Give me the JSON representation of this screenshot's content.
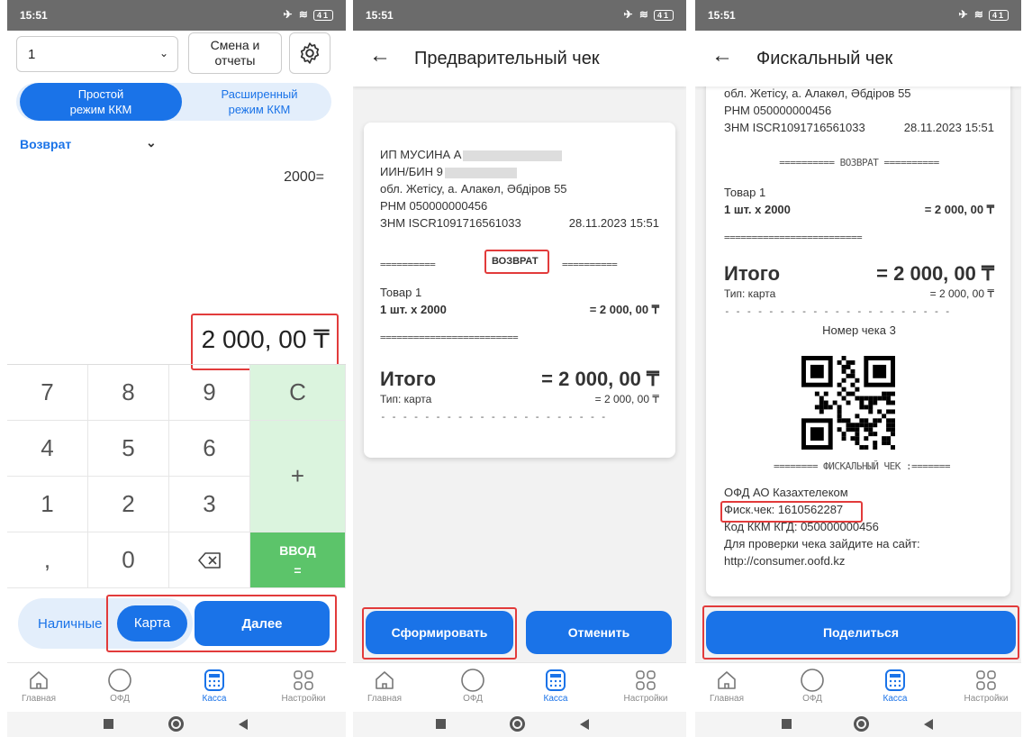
{
  "status": {
    "time": "15:51",
    "battery": "41"
  },
  "screen1": {
    "select_value": "1",
    "shift_button": "Смена и\nотчеты",
    "mode_simple": "Простой\nрежим ККМ",
    "mode_extended": "Расширенный\nрежим ККМ",
    "operation": "Возврат",
    "expression": "2000=",
    "amount": "2 000, 00 ₸",
    "keys": [
      "7",
      "8",
      "9",
      "C",
      "4",
      "5",
      "6",
      "+",
      "1",
      "2",
      "3",
      ",",
      "0"
    ],
    "enter_label": "ВВОД\n=",
    "pay_cash": "Наличные",
    "pay_card": "Карта",
    "next_button": "Далее"
  },
  "screen2": {
    "title": "Предварительный чек",
    "seller": "ИП МУСИНА А",
    "iin": "ИИН/БИН 9",
    "address": "обл. Жетісу, а. Алакөл, Әбдіров 55",
    "rnm": "РНМ 050000000456",
    "znm": "ЗНМ ISCR1091716561033",
    "datetime": "28.11.2023 15:51",
    "sep_left": "==========",
    "op_label": "ВОЗВРАТ",
    "sep_right": "==========",
    "item_name": "Товар 1",
    "item_qty": "1 шт. x 2000",
    "item_sum": "= 2 000, 00 ₸",
    "sep_full": "=========================",
    "total_label": "Итого",
    "total_value": "= 2 000, 00 ₸",
    "pay_type": "Тип: карта",
    "pay_sum": "= 2 000, 00 ₸",
    "dash_line": "- - - - - - - - - - - - - - - - - - - - -",
    "form_button": "Сформировать",
    "cancel_button": "Отменить"
  },
  "screen3": {
    "title": "Фискальный чек",
    "address": "обл. Жетісу, а. Алакөл, Әбдіров 55",
    "rnm": "РНМ 050000000456",
    "znm": "ЗНМ ISCR1091716561033",
    "datetime": "28.11.2023 15:51",
    "sep_op": "==========  ВОЗВРАТ  ==========",
    "item_name": "Товар 1",
    "item_qty": "1 шт. x 2000",
    "item_sum": "= 2 000, 00 ₸",
    "sep_full": "=========================",
    "total_label": "Итого",
    "total_value": "= 2 000, 00 ₸",
    "pay_type": "Тип: карта",
    "pay_sum": "= 2 000, 00 ₸",
    "dash_line": "- - - - - - - - - - - - - - - - - - - - -",
    "receipt_number": "Номер чека 3",
    "sep_fiscal": "========  ФИСКАЛЬНЫЙ ЧЕК  :=======",
    "ofd": "ОФД АО Казахтелеком",
    "fisk": "Фиск.чек: 1610562287",
    "kkm_code": "Код ККМ КГД: 050000000456",
    "check_site": "Для проверки чека зайдите на сайт:",
    "site_url": "http://consumer.oofd.kz",
    "share_button": "Поделиться"
  },
  "nav": {
    "home": "Главная",
    "ofd": "ОФД",
    "kassa": "Касса",
    "settings": "Настройки"
  },
  "colors": {
    "accent": "#1a73e8",
    "green": "#5cc46a",
    "light_green": "#dbf4de",
    "highlight": "#e23b3b"
  }
}
